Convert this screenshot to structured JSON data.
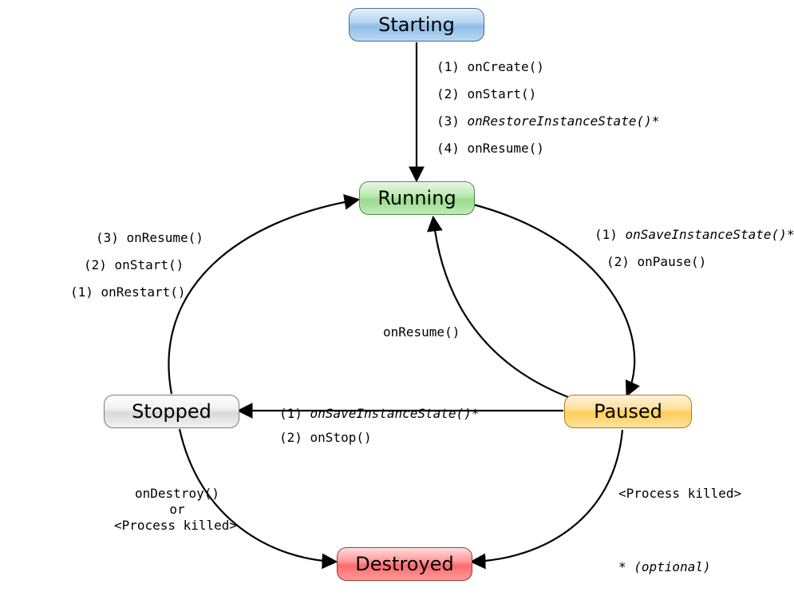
{
  "states": {
    "starting": {
      "label": "Starting"
    },
    "running": {
      "label": "Running"
    },
    "stopped": {
      "label": "Stopped"
    },
    "paused": {
      "label": "Paused"
    },
    "destroyed": {
      "label": "Destroyed"
    }
  },
  "edges": {
    "starting_to_running": {
      "lines": [
        {
          "text": "(1) onCreate()"
        },
        {
          "text": "(2) onStart()"
        },
        {
          "text": "(3) onRestoreInstanceState()*",
          "italic_part": "onRestoreInstanceState()*"
        },
        {
          "text": "(4) onResume()"
        }
      ]
    },
    "running_to_paused": {
      "lines": [
        {
          "text": "(1) onSaveInstanceState()*",
          "italic_part": "onSaveInstanceState()*"
        },
        {
          "text": "(2) onPause()"
        }
      ]
    },
    "paused_to_running": {
      "lines": [
        {
          "text": "onResume()"
        }
      ]
    },
    "paused_to_stopped": {
      "lines": [
        {
          "text": "(1) onSaveInstanceState()*",
          "italic_part": "onSaveInstanceState()*"
        },
        {
          "text": "(2) onStop()"
        }
      ]
    },
    "stopped_to_running": {
      "lines": [
        {
          "text": "(3) onResume()"
        },
        {
          "text": "(2) onStart()"
        },
        {
          "text": "(1) onRestart()"
        }
      ]
    },
    "stopped_to_destroyed": {
      "line1": "onDestroy()",
      "line2": "or",
      "line3": "<Process killed>"
    },
    "paused_to_destroyed": {
      "line1": "<Process killed>"
    }
  },
  "footnote": "* (optional)"
}
